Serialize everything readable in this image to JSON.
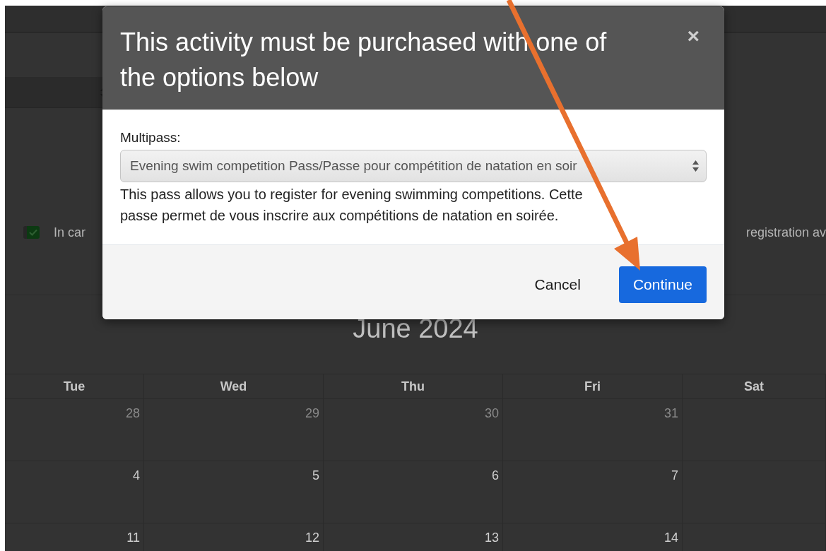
{
  "page": {
    "checkbox_row": {
      "checked": true,
      "label_visible_start": "In car",
      "label_visible_end": "registration av"
    },
    "calendar": {
      "title": "June 2024",
      "weekdays": [
        "Tue",
        "Wed",
        "Thu",
        "Fri",
        "Sat"
      ],
      "weeks": [
        [
          {
            "day": "28",
            "muted": true
          },
          {
            "day": "29",
            "muted": true
          },
          {
            "day": "30",
            "muted": true
          },
          {
            "day": "31",
            "muted": true
          }
        ],
        [
          {
            "day": "4",
            "muted": false
          },
          {
            "day": "5",
            "muted": false
          },
          {
            "day": "6",
            "muted": false
          },
          {
            "day": "7",
            "muted": false
          }
        ],
        [
          {
            "day": "11",
            "muted": false
          },
          {
            "day": "12",
            "muted": false
          },
          {
            "day": "13",
            "muted": false
          },
          {
            "day": "14",
            "muted": false
          }
        ]
      ]
    }
  },
  "dialog": {
    "title": "This activity must be purchased with one of the options below",
    "close": "×",
    "field_label": "Multipass:",
    "select_value": "Evening swim competition Pass/Passe pour compétition de natation en soir",
    "description": "This pass allows you to register for evening swimming competitions. Cette passe permet de vous inscrire aux compétitions de natation en soirée.",
    "buttons": [
      {
        "label": "Cancel",
        "kind": "secondary"
      },
      {
        "label": "Continue",
        "kind": "primary"
      }
    ]
  }
}
